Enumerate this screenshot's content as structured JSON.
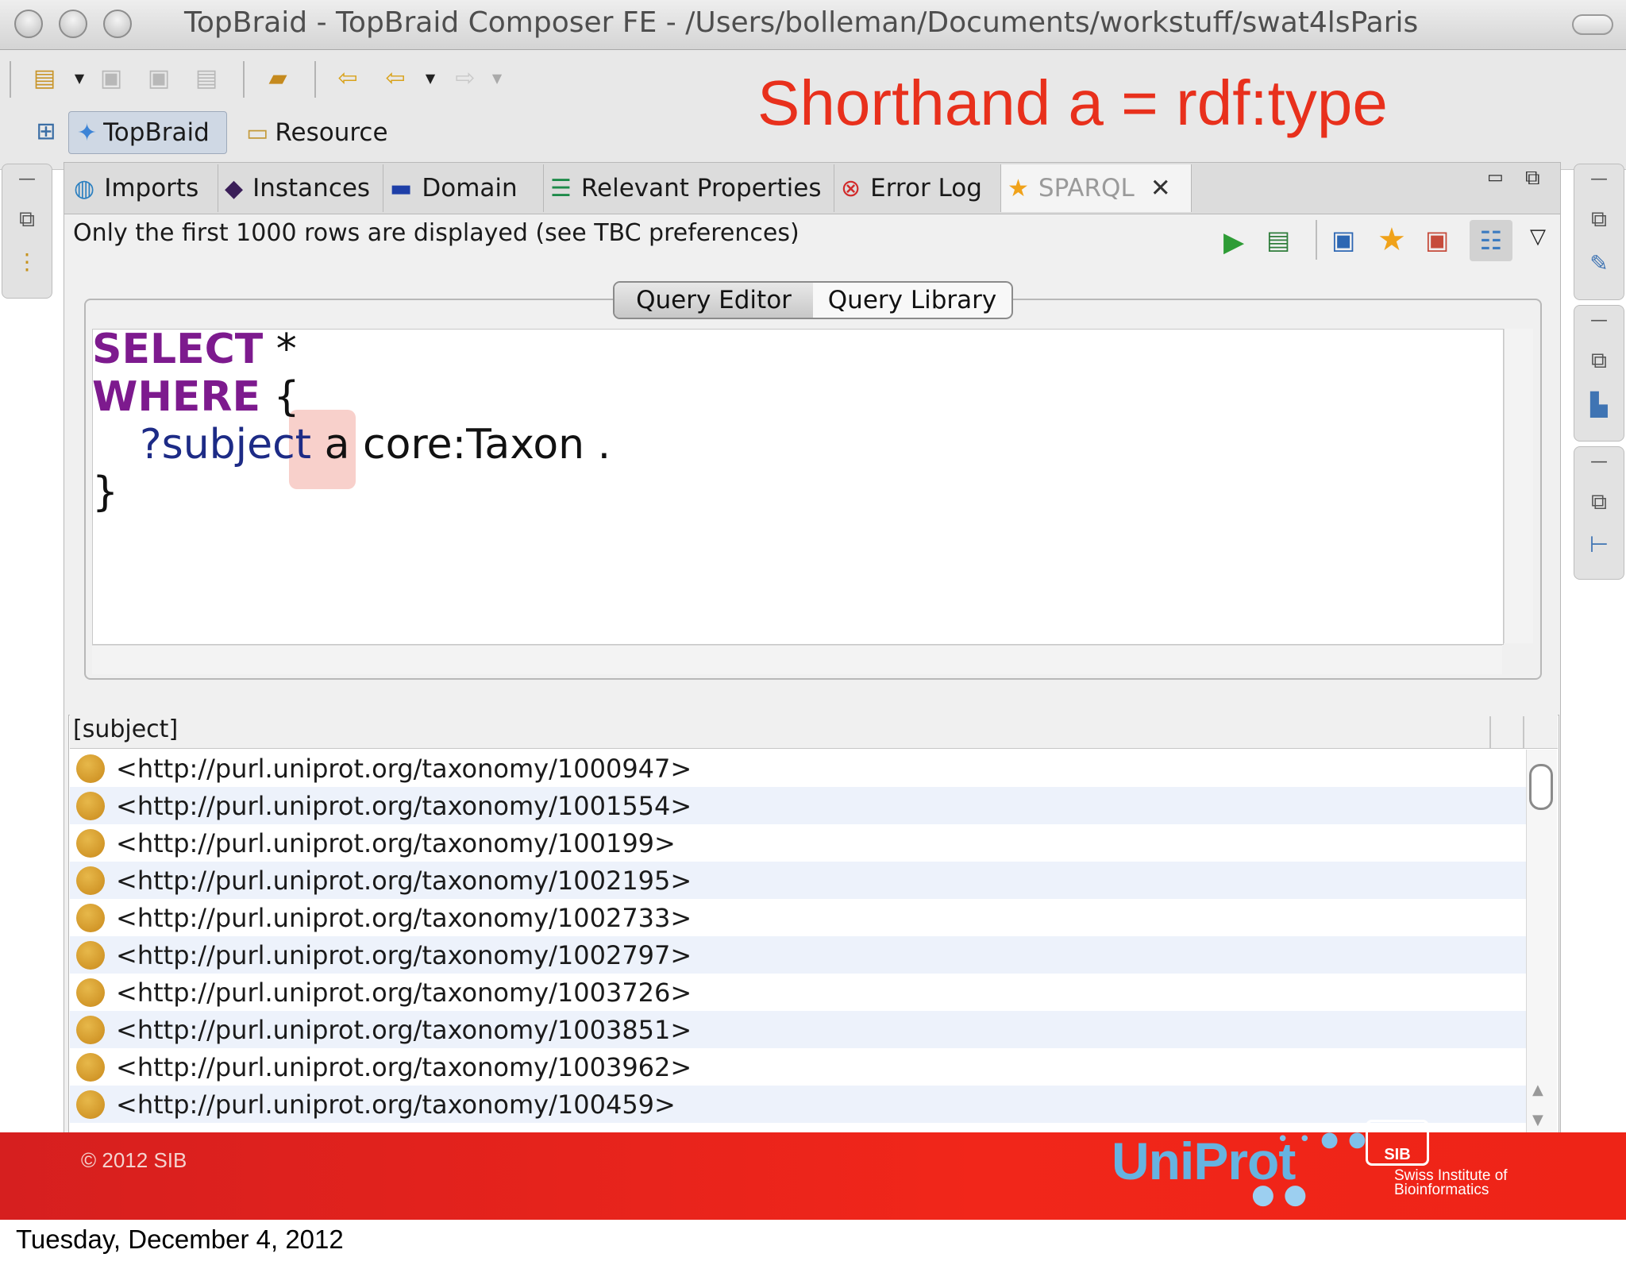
{
  "window": {
    "title": "TopBraid - TopBraid Composer FE - /Users/bolleman/Documents/workstuff/swat4lsParis"
  },
  "annotation": "Shorthand a = rdf:type",
  "perspectives": [
    {
      "label": "TopBraid",
      "icon": "topbraid-icon"
    },
    {
      "label": "Resource",
      "icon": "resource-icon"
    }
  ],
  "tabs": [
    {
      "label": "Imports",
      "icon": "imports-icon"
    },
    {
      "label": "Instances",
      "icon": "diamond-icon"
    },
    {
      "label": "Domain",
      "icon": "domain-icon"
    },
    {
      "label": "Relevant Properties",
      "icon": "properties-icon"
    },
    {
      "label": "Error Log",
      "icon": "error-log-icon"
    },
    {
      "label": "SPARQL",
      "icon": "star-icon",
      "close": "✕"
    }
  ],
  "status_message": "Only the first 1000 rows are displayed (see TBC preferences)",
  "subtabs": [
    {
      "label": "Query Editor",
      "selected": true
    },
    {
      "label": "Query Library",
      "selected": false
    }
  ],
  "query": {
    "line1_kw": "SELECT",
    "line1_rest": "*",
    "line2_kw": "WHERE",
    "line2_rest": "{",
    "line3_var": "?subject",
    "line3_a": "a",
    "line3_rest": "core:Taxon .",
    "line4": "}"
  },
  "results": {
    "column": "[subject]",
    "rows": [
      "<http://purl.uniprot.org/taxonomy/1000947>",
      "<http://purl.uniprot.org/taxonomy/1001554>",
      "<http://purl.uniprot.org/taxonomy/100199>",
      "<http://purl.uniprot.org/taxonomy/1002195>",
      "<http://purl.uniprot.org/taxonomy/1002733>",
      "<http://purl.uniprot.org/taxonomy/1002797>",
      "<http://purl.uniprot.org/taxonomy/1003726>",
      "<http://purl.uniprot.org/taxonomy/1003851>",
      "<http://purl.uniprot.org/taxonomy/1003962>",
      "<http://purl.uniprot.org/taxonomy/100459>"
    ]
  },
  "footer": {
    "copyright": "© 2012 SIB",
    "uniprot": "UniProt",
    "sib": "SIB",
    "sib_line1": "Swiss Institute of",
    "sib_line2": "Bioinformatics"
  },
  "date": "Tuesday, December 4, 2012",
  "colors": {
    "annotation": "#e8301c",
    "keyword": "#7d1a8e",
    "variable": "#1d2b86",
    "footer_red": "#f1261a",
    "uniprot_blue": "#66b3e0"
  }
}
